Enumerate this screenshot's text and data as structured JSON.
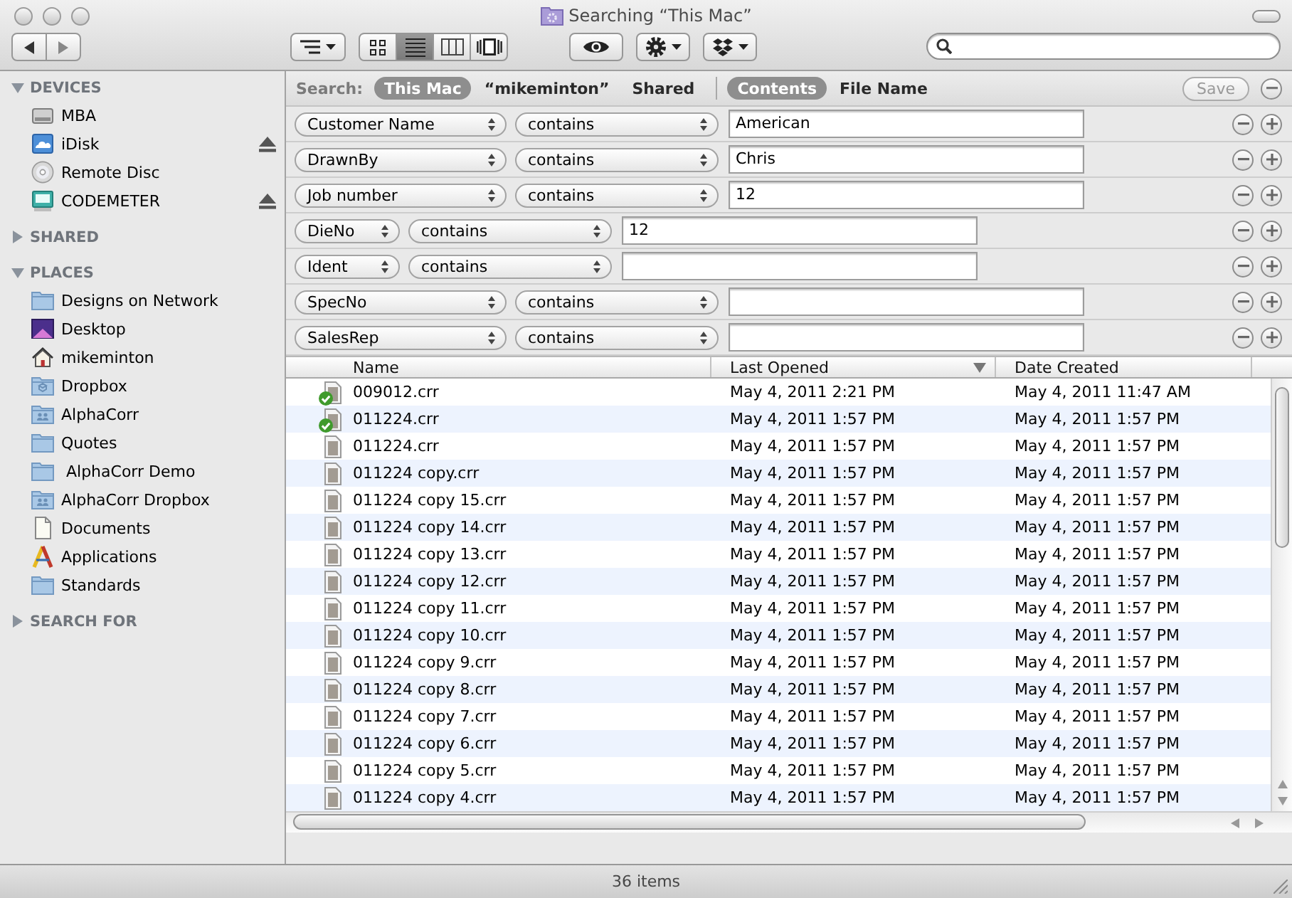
{
  "window": {
    "title": "Searching “This Mac”"
  },
  "toolbar": {
    "view_modes": [
      {
        "kind": "icons",
        "selected": false
      },
      {
        "kind": "list",
        "selected": true
      },
      {
        "kind": "columns",
        "selected": false
      },
      {
        "kind": "coverflow",
        "selected": false
      }
    ]
  },
  "sidebar": {
    "sections": [
      {
        "title": "DEVICES",
        "expanded": true,
        "items": [
          {
            "label": "MBA",
            "kind": "drive",
            "ejectable": false
          },
          {
            "label": "iDisk",
            "kind": "idisk",
            "ejectable": true
          },
          {
            "label": "Remote Disc",
            "kind": "disc",
            "ejectable": false
          },
          {
            "label": "CODEMETER",
            "kind": "external-drive",
            "ejectable": true
          }
        ]
      },
      {
        "title": "SHARED",
        "expanded": false
      },
      {
        "title": "PLACES",
        "expanded": true,
        "items": [
          {
            "label": "Designs on Network",
            "kind": "folder"
          },
          {
            "label": "Desktop",
            "kind": "desktop"
          },
          {
            "label": "mikeminton",
            "kind": "home"
          },
          {
            "label": "Dropbox",
            "kind": "box-folder"
          },
          {
            "label": "AlphaCorr",
            "kind": "people-folder"
          },
          {
            "label": "Quotes",
            "kind": "folder"
          },
          {
            "label": " AlphaCorr Demo",
            "kind": "folder"
          },
          {
            "label": "AlphaCorr Dropbox",
            "kind": "people-folder"
          },
          {
            "label": "Documents",
            "kind": "document"
          },
          {
            "label": "Applications",
            "kind": "applications"
          },
          {
            "label": "Standards",
            "kind": "folder"
          }
        ]
      },
      {
        "title": "SEARCH FOR",
        "expanded": false
      }
    ]
  },
  "search_bar": {
    "label": "Search:",
    "scopes": [
      {
        "label": "This Mac",
        "selected": true
      },
      {
        "label": "“mikeminton”",
        "selected": false
      },
      {
        "label": "Shared",
        "selected": false
      }
    ],
    "match": [
      {
        "label": "Contents",
        "selected": true
      },
      {
        "label": "File Name",
        "selected": false
      }
    ],
    "save": {
      "label": "Save",
      "disabled": true
    }
  },
  "criteria": [
    {
      "attribute": "Customer Name",
      "operator": "contains",
      "value": "American"
    },
    {
      "attribute": "DrawnBy",
      "operator": "contains",
      "value": "Chris"
    },
    {
      "attribute": "Job number",
      "operator": "contains",
      "value": "12"
    },
    {
      "attribute": "DieNo",
      "operator": "contains",
      "value": "12"
    },
    {
      "attribute": "Ident",
      "operator": "contains"
    },
    {
      "attribute": "SpecNo",
      "operator": "contains"
    },
    {
      "attribute": "SalesRep",
      "operator": "contains"
    }
  ],
  "table": {
    "columns": [
      {
        "label": "Name",
        "sorted": false
      },
      {
        "label": "Last Opened",
        "sorted": true
      },
      {
        "label": "Date Created",
        "sorted": false
      }
    ],
    "rows": [
      {
        "name": "009012.crr",
        "check_badge": true,
        "last_opened": "May 4, 2011 2:21 PM",
        "date_created": "May 4, 2011 11:47 AM"
      },
      {
        "name": "011224.crr",
        "check_badge": true,
        "last_opened": "May 4, 2011 1:57 PM",
        "date_created": "May 4, 2011 1:57 PM"
      },
      {
        "name": "011224.crr",
        "check_badge": false,
        "last_opened": "May 4, 2011 1:57 PM",
        "date_created": "May 4, 2011 1:57 PM"
      },
      {
        "name": "011224 copy.crr",
        "check_badge": false,
        "last_opened": "May 4, 2011 1:57 PM",
        "date_created": "May 4, 2011 1:57 PM"
      },
      {
        "name": "011224 copy 15.crr",
        "check_badge": false,
        "last_opened": "May 4, 2011 1:57 PM",
        "date_created": "May 4, 2011 1:57 PM"
      },
      {
        "name": "011224 copy 14.crr",
        "check_badge": false,
        "last_opened": "May 4, 2011 1:57 PM",
        "date_created": "May 4, 2011 1:57 PM"
      },
      {
        "name": "011224 copy 13.crr",
        "check_badge": false,
        "last_opened": "May 4, 2011 1:57 PM",
        "date_created": "May 4, 2011 1:57 PM"
      },
      {
        "name": "011224 copy 12.crr",
        "check_badge": false,
        "last_opened": "May 4, 2011 1:57 PM",
        "date_created": "May 4, 2011 1:57 PM"
      },
      {
        "name": "011224 copy 11.crr",
        "check_badge": false,
        "last_opened": "May 4, 2011 1:57 PM",
        "date_created": "May 4, 2011 1:57 PM"
      },
      {
        "name": "011224 copy 10.crr",
        "check_badge": false,
        "last_opened": "May 4, 2011 1:57 PM",
        "date_created": "May 4, 2011 1:57 PM"
      },
      {
        "name": "011224 copy 9.crr",
        "check_badge": false,
        "last_opened": "May 4, 2011 1:57 PM",
        "date_created": "May 4, 2011 1:57 PM"
      },
      {
        "name": "011224 copy 8.crr",
        "check_badge": false,
        "last_opened": "May 4, 2011 1:57 PM",
        "date_created": "May 4, 2011 1:57 PM"
      },
      {
        "name": "011224 copy 7.crr",
        "check_badge": false,
        "last_opened": "May 4, 2011 1:57 PM",
        "date_created": "May 4, 2011 1:57 PM"
      },
      {
        "name": "011224 copy 6.crr",
        "check_badge": false,
        "last_opened": "May 4, 2011 1:57 PM",
        "date_created": "May 4, 2011 1:57 PM"
      },
      {
        "name": "011224 copy 5.crr",
        "check_badge": false,
        "last_opened": "May 4, 2011 1:57 PM",
        "date_created": "May 4, 2011 1:57 PM"
      },
      {
        "name": "011224 copy 4.crr",
        "check_badge": false,
        "last_opened": "May 4, 2011 1:57 PM",
        "date_created": "May 4, 2011 1:57 PM"
      }
    ]
  },
  "status_bar": {
    "text": "36 items"
  }
}
